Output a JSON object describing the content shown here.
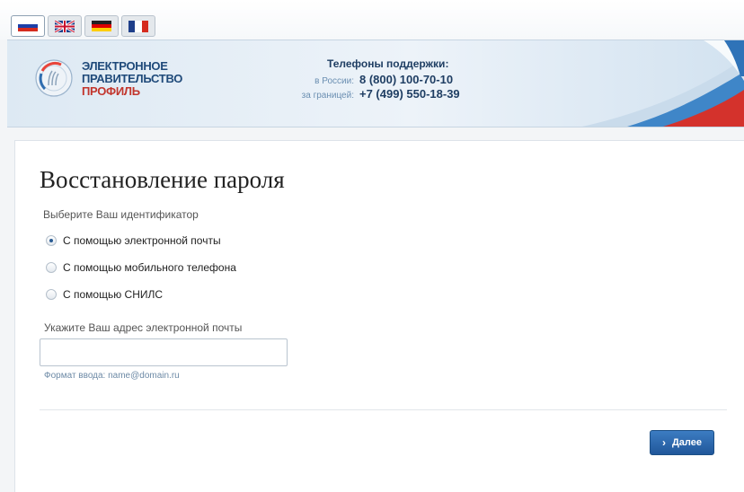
{
  "languages": [
    {
      "code": "ru",
      "active": true
    },
    {
      "code": "en",
      "active": false
    },
    {
      "code": "de",
      "active": false
    },
    {
      "code": "fr",
      "active": false
    }
  ],
  "header": {
    "brand_line1": "ЭЛЕКТРОННОЕ",
    "brand_line2": "ПРАВИТЕЛЬСТВО",
    "brand_line3": "ПРОФИЛЬ",
    "support_title": "Телефоны поддержки:",
    "support_rows": [
      {
        "label": "в России:",
        "number": "8 (800) 100-70-10"
      },
      {
        "label": "за границей:",
        "number": "+7 (499) 550-18-39"
      }
    ],
    "colors": {
      "brand_blue": "#1f4a7a",
      "brand_red": "#c2352c"
    }
  },
  "main": {
    "title": "Восстановление пароля",
    "choose_label": "Выберите Ваш идентификатор",
    "options": [
      {
        "label": "С помощью электронной почты",
        "checked": true
      },
      {
        "label": "С помощью мобильного телефона",
        "checked": false
      },
      {
        "label": "С помощью СНИЛС",
        "checked": false
      }
    ],
    "email_label": "Укажите Ваш адрес электронной почты",
    "email_value": "",
    "format_hint": "Формат ввода: name@domain.ru",
    "next_button": "Далее",
    "colors": {
      "button": "#2a65a8",
      "hint": "#6d8aa6"
    }
  }
}
